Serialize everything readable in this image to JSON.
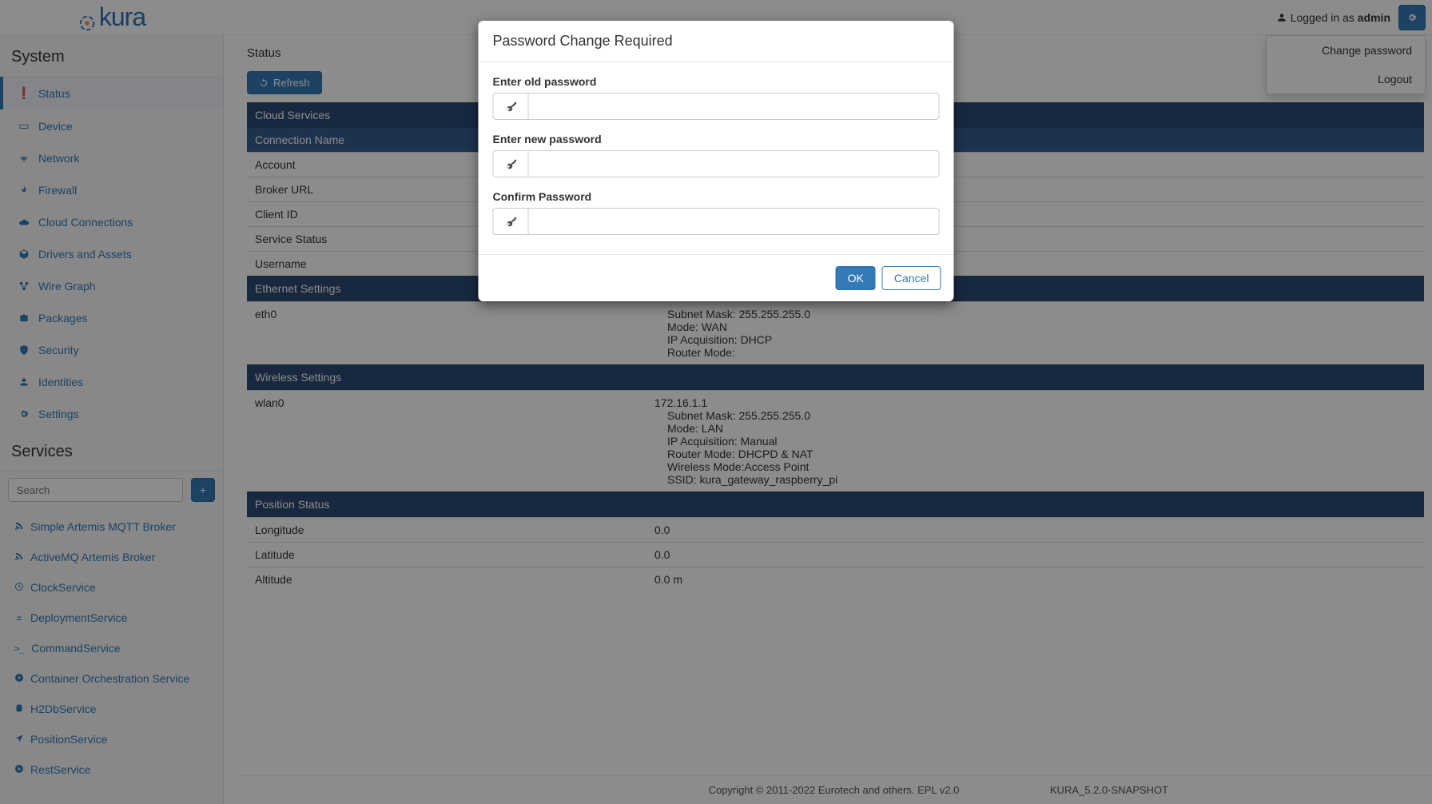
{
  "header": {
    "logo_text": "kura",
    "logged_in_prefix": "Logged in as",
    "username": "admin"
  },
  "user_menu": {
    "change_password": "Change password",
    "logout": "Logout"
  },
  "sidebar": {
    "system_title": "System",
    "items": [
      {
        "label": "Status",
        "icon": "!"
      },
      {
        "label": "Device",
        "icon": "hdd"
      },
      {
        "label": "Network",
        "icon": "wifi"
      },
      {
        "label": "Firewall",
        "icon": "fire"
      },
      {
        "label": "Cloud Connections",
        "icon": "cloud"
      },
      {
        "label": "Drivers and Assets",
        "icon": "package"
      },
      {
        "label": "Wire Graph",
        "icon": "graph"
      },
      {
        "label": "Packages",
        "icon": "briefcase"
      },
      {
        "label": "Security",
        "icon": "shield"
      },
      {
        "label": "Identities",
        "icon": "user"
      },
      {
        "label": "Settings",
        "icon": "gear"
      }
    ],
    "services_title": "Services",
    "search_placeholder": "Search",
    "services": [
      {
        "label": "Simple Artemis MQTT Broker",
        "icon": "rss"
      },
      {
        "label": "ActiveMQ Artemis Broker",
        "icon": "rss"
      },
      {
        "label": "ClockService",
        "icon": "clock"
      },
      {
        "label": "DeploymentService",
        "icon": "download"
      },
      {
        "label": "CommandService",
        "icon": "terminal"
      },
      {
        "label": "Container Orchestration Service",
        "icon": "arrow-right"
      },
      {
        "label": "H2DbService",
        "icon": "db"
      },
      {
        "label": "PositionService",
        "icon": "location"
      },
      {
        "label": "RestService",
        "icon": "arrow-right"
      }
    ]
  },
  "main": {
    "title": "Status",
    "refresh_label": "Refresh",
    "sections": {
      "cloud_services": "Cloud Services",
      "connection_name": "Connection Name",
      "cloud_rows": [
        "Account",
        "Broker URL",
        "Client ID",
        "Service Status",
        "Username"
      ],
      "ethernet": "Ethernet Settings",
      "eth0_label": "eth0",
      "eth0_lines": [
        "Subnet Mask: 255.255.255.0",
        "Mode: WAN",
        "IP Acquisition: DHCP",
        "Router Mode:"
      ],
      "wireless": "Wireless Settings",
      "wlan0_label": "wlan0",
      "wlan0_ip": "172.16.1.1",
      "wlan0_lines": [
        "Subnet Mask: 255.255.255.0",
        "Mode: LAN",
        "IP Acquisition: Manual",
        "Router Mode: DHCPD & NAT",
        "Wireless Mode:Access Point",
        "SSID: kura_gateway_raspberry_pi"
      ],
      "position": "Position Status",
      "position_rows": [
        {
          "label": "Longitude",
          "value": "0.0"
        },
        {
          "label": "Latitude",
          "value": "0.0"
        },
        {
          "label": "Altitude",
          "value": "0.0 m"
        }
      ]
    }
  },
  "footer": {
    "copyright": "Copyright © 2011-2022 Eurotech and others. EPL v2.0",
    "version": "KURA_5.2.0-SNAPSHOT"
  },
  "modal": {
    "title": "Password Change Required",
    "old_label": "Enter old password",
    "new_label": "Enter new password",
    "confirm_label": "Confirm Password",
    "ok": "OK",
    "cancel": "Cancel"
  }
}
